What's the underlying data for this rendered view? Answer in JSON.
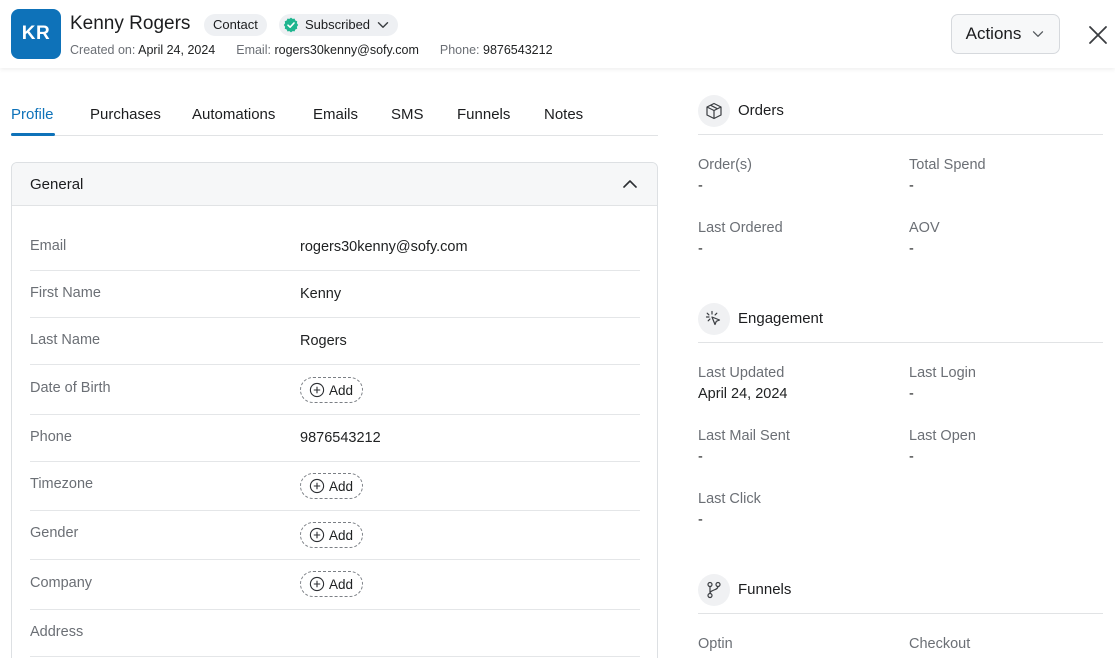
{
  "header": {
    "initials": "KR",
    "name": "Kenny Rogers",
    "contact_badge": "Contact",
    "status_badge": "Subscribed",
    "created_label": "Created on:",
    "created_value": "April 24, 2024",
    "email_label": "Email:",
    "email_value": "rogers30kenny@sofy.com",
    "phone_label": "Phone:",
    "phone_value": "9876543212",
    "actions_label": "Actions"
  },
  "tabs": [
    {
      "label": "Profile",
      "active": true
    },
    {
      "label": "Purchases"
    },
    {
      "label": "Automations"
    },
    {
      "label": "Emails"
    },
    {
      "label": "SMS"
    },
    {
      "label": "Funnels"
    },
    {
      "label": "Notes"
    }
  ],
  "general": {
    "title": "General",
    "add_label": "Add",
    "fields": [
      {
        "label": "Email",
        "value": "rogers30kenny@sofy.com"
      },
      {
        "label": "First Name",
        "value": "Kenny"
      },
      {
        "label": "Last Name",
        "value": "Rogers"
      },
      {
        "label": "Date of Birth",
        "value": null
      },
      {
        "label": "Phone",
        "value": "9876543212"
      },
      {
        "label": "Timezone",
        "value": null
      },
      {
        "label": "Gender",
        "value": null
      },
      {
        "label": "Company",
        "value": null
      },
      {
        "label": "Address",
        "value": ""
      }
    ]
  },
  "orders": {
    "title": "Orders",
    "icon": "box-icon",
    "stats": [
      {
        "label": "Order(s)",
        "value": "-"
      },
      {
        "label": "Total Spend",
        "value": "-"
      },
      {
        "label": "Last Ordered",
        "value": "-"
      },
      {
        "label": "AOV",
        "value": "-"
      }
    ]
  },
  "engagement": {
    "title": "Engagement",
    "icon": "cursor-click-icon",
    "stats": [
      {
        "label": "Last Updated",
        "value": "April 24, 2024"
      },
      {
        "label": "Last Login",
        "value": "-"
      },
      {
        "label": "Last Mail Sent",
        "value": "-"
      },
      {
        "label": "Last Open",
        "value": "-"
      },
      {
        "label": "Last Click",
        "value": "-"
      }
    ]
  },
  "funnels": {
    "title": "Funnels",
    "icon": "branch-icon",
    "stats": [
      {
        "label": "Optin",
        "value": ""
      },
      {
        "label": "Checkout",
        "value": ""
      }
    ]
  },
  "colors": {
    "accent": "#0e72b9",
    "subscribed": "#1fb58f"
  }
}
